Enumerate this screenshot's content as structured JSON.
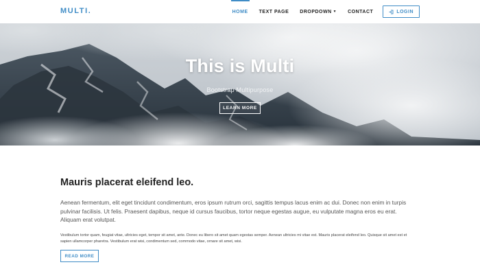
{
  "brand": "MULTI.",
  "nav": {
    "items": [
      {
        "label": "HOME",
        "active": true
      },
      {
        "label": "TEXT PAGE",
        "active": false
      },
      {
        "label": "DROPDOWN",
        "active": false
      },
      {
        "label": "CONTACT",
        "active": false
      }
    ],
    "login_label": "LOGIN",
    "login_icon": "login-icon"
  },
  "hero": {
    "title": "This is Multi",
    "subtitle": "Bootstrap Multipurpose",
    "button_label": "LEARN MORE"
  },
  "section": {
    "heading": "Mauris placerat eleifend leo.",
    "lead": "Aenean fermentum, elit eget tincidunt condimentum, eros ipsum rutrum orci, sagittis tempus lacus enim ac dui. Donec non enim in turpis pulvinar facilisis. Ut felis. Praesent dapibus, neque id cursus faucibus, tortor neque egestas augue, eu vulputate magna eros eu erat. Aliquam erat volutpat.",
    "small": "Vestibulum tortor quam, feugiat vitae, ultricies eget, tempor sit amet, ante. Donec eu libero sit amet quam egestas semper. Aenean ultricies mi vitae est. Mauris placerat eleifend leo. Quisque sit amet est et sapien ullamcorper pharetra. Vestibulum erat wisi, condimentum sed, commodo vitae, ornare sit amet, wisi.",
    "button_label": "READ MORE"
  },
  "colors": {
    "accent": "#3f8cc6"
  }
}
